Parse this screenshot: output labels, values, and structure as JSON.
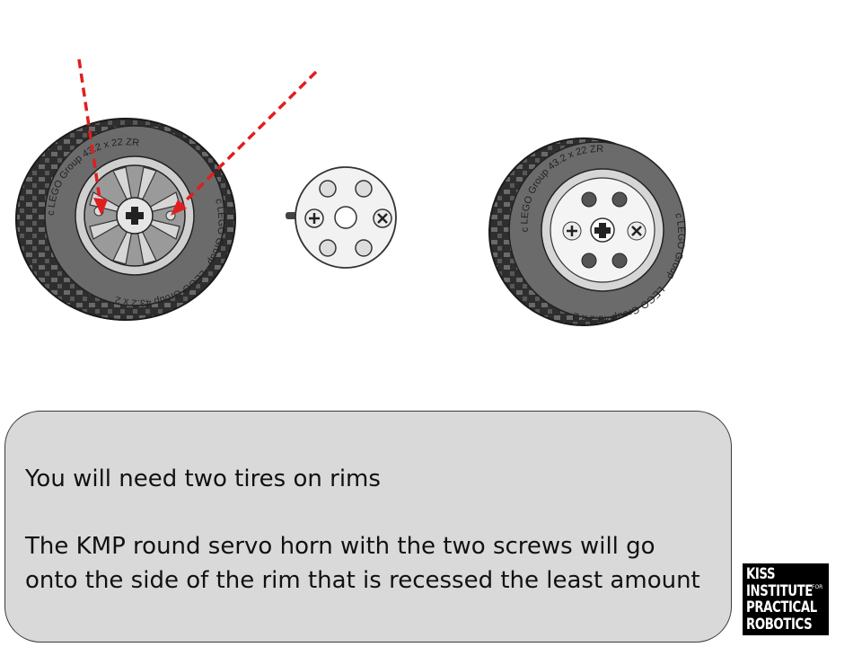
{
  "tire_imprint": {
    "top": "c LEGO Group 43.2 x 22 ZR",
    "side": "c LEGO Group",
    "bottom": "LEGO Group 43.2 x 22 ZR"
  },
  "callout": {
    "line1": "You will need two tires on rims",
    "line2": "The KMP round servo horn with the two screws will go",
    "line3": "onto the side of the rim that is recessed the least amount"
  },
  "logo": {
    "line1": "KISS",
    "line2": "INSTITUTE",
    "for": "FOR",
    "line3": "PRACTICAL",
    "line4": "ROBOTICS"
  },
  "colors": {
    "arrow": "#e01e1e",
    "tire": "#5a5a5a",
    "rim": "#b8b8b8",
    "callout_bg": "#d9d9d9"
  }
}
